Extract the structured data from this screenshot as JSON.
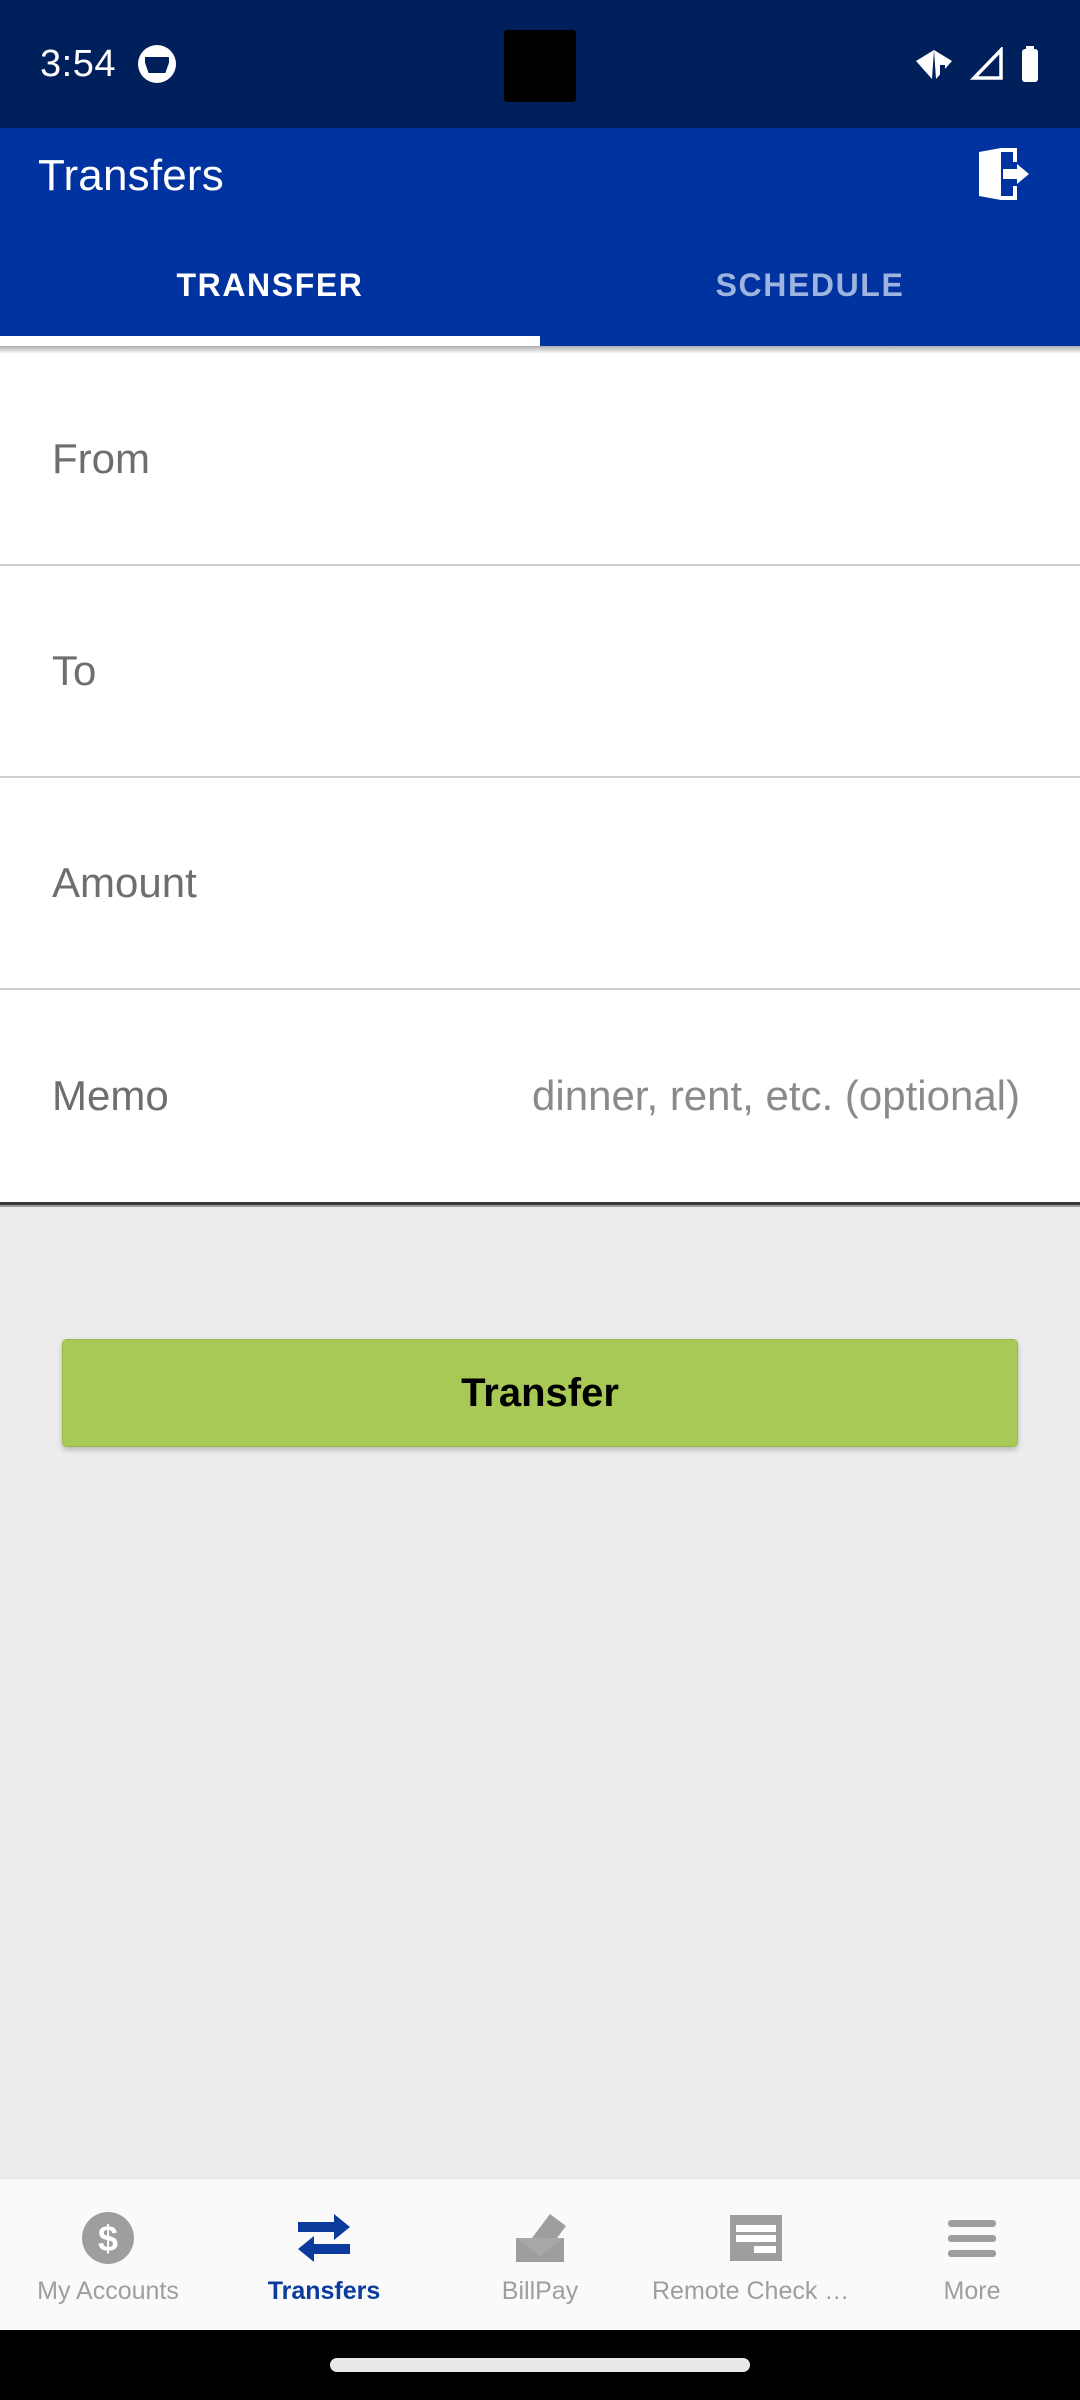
{
  "status_bar": {
    "time": "3:54",
    "icons": [
      "emoji-notification-icon",
      "wifi-warning-icon",
      "cell-signal-icon",
      "battery-icon"
    ]
  },
  "app_bar": {
    "title": "Transfers",
    "logout_icon": "logout-icon"
  },
  "tabs": [
    {
      "label": "TRANSFER",
      "active": true
    },
    {
      "label": "SCHEDULE",
      "active": false
    }
  ],
  "form": {
    "rows": [
      {
        "label": "From",
        "value": ""
      },
      {
        "label": "To",
        "value": ""
      },
      {
        "label": "Amount",
        "value": ""
      },
      {
        "label": "Memo",
        "value": "dinner, rent, etc. (optional)"
      }
    ]
  },
  "actions": {
    "primary_label": "Transfer"
  },
  "bottom_nav": {
    "items": [
      {
        "label": "My Accounts",
        "icon": "dollar-circle-icon",
        "active": false
      },
      {
        "label": "Transfers",
        "icon": "transfer-arrows-icon",
        "active": true
      },
      {
        "label": "BillPay",
        "icon": "envelope-icon",
        "active": false
      },
      {
        "label": "Remote Check D…",
        "icon": "check-card-icon",
        "active": false
      },
      {
        "label": "More",
        "icon": "hamburger-icon",
        "active": false
      }
    ]
  },
  "colors": {
    "status_bar": "#00205b",
    "app_bar": "#0033a0",
    "accent_green": "#a8c955",
    "active_blue": "#0b3b9c",
    "content_bg": "#ececec",
    "inactive_gray": "#9e9e9e"
  }
}
